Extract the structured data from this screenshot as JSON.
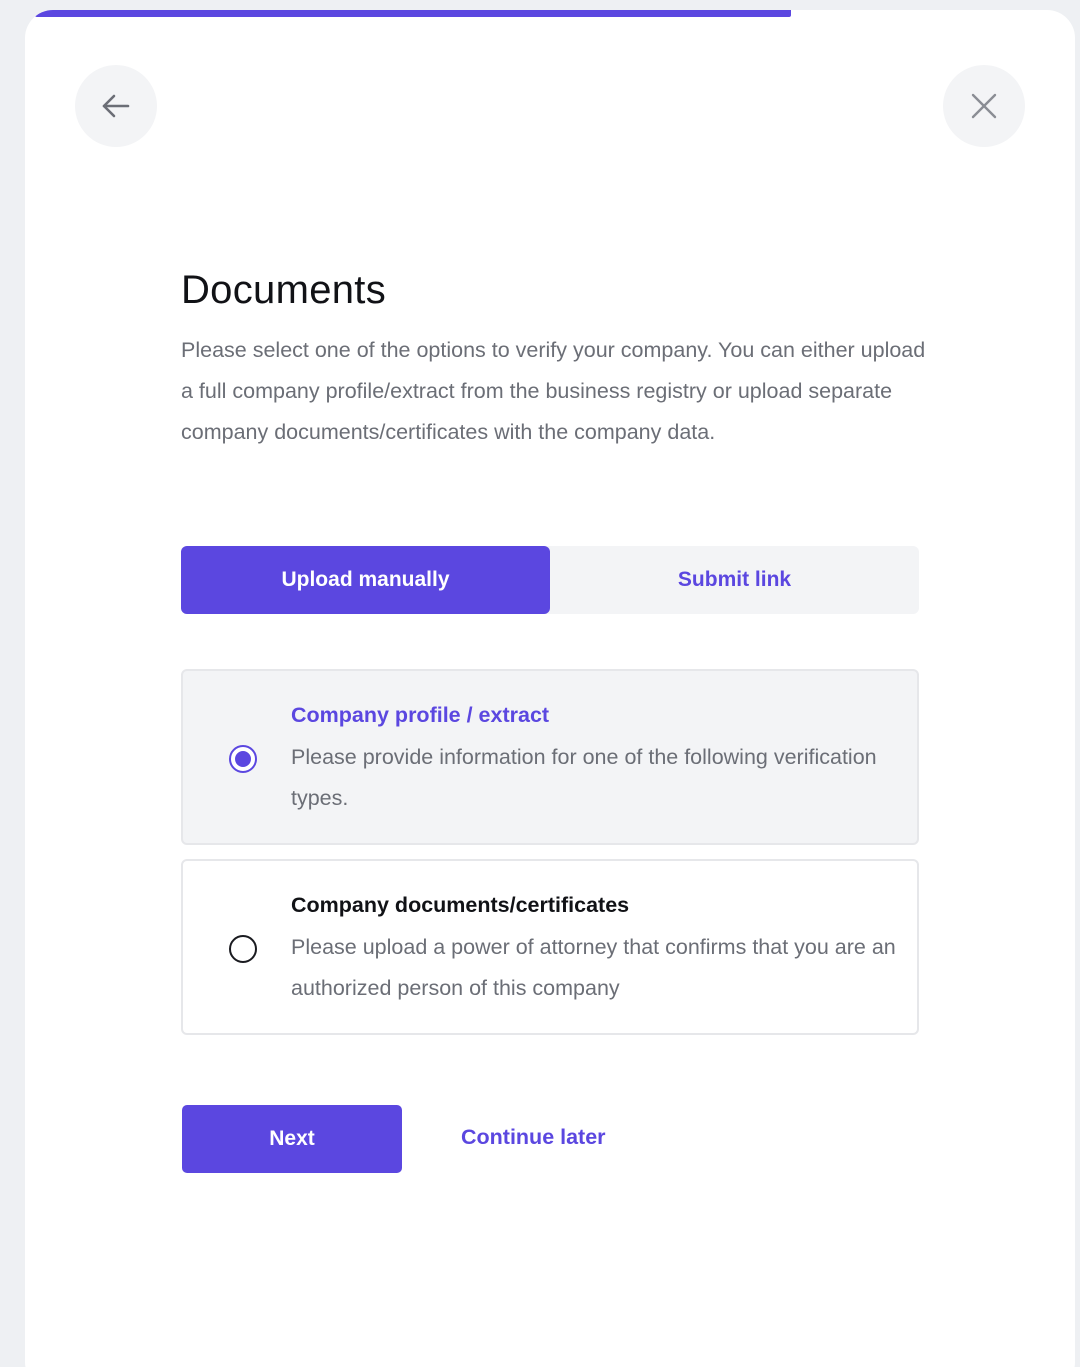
{
  "progress": {
    "value_percent": 72,
    "color": "#5b47e0"
  },
  "header": {
    "back_icon": "arrow-left-icon",
    "close_icon": "close-icon"
  },
  "page": {
    "title": "Documents",
    "description": "Please select one of the options to verify your company. You can either upload a full company profile/extract from the business registry or upload separate company documents/certificates with the company data."
  },
  "tabs": [
    {
      "label": "Upload manually",
      "active": true
    },
    {
      "label": "Submit link",
      "active": false
    }
  ],
  "options": [
    {
      "title": "Company profile / extract",
      "description": "Please provide information for one of the following verification types.",
      "selected": true
    },
    {
      "title": "Company documents/certificates",
      "description": "Please upload a power of attorney that confirms that you are an authorized person of this company",
      "selected": false
    }
  ],
  "actions": {
    "next_label": "Next",
    "later_label": "Continue later"
  },
  "colors": {
    "accent": "#5b47e0",
    "text_primary": "#111216",
    "text_secondary": "#6b6e76",
    "surface_muted": "#f3f4f6"
  }
}
